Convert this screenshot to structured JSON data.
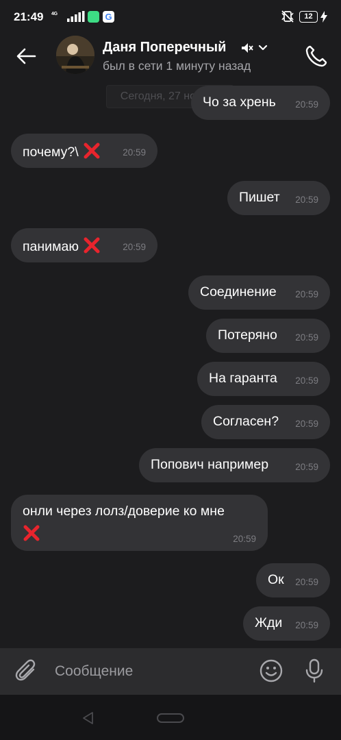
{
  "status_bar": {
    "time": "21:49",
    "network": "4G",
    "battery": "12"
  },
  "header": {
    "contact_name": "Даня Поперечный",
    "contact_status": "был в сети 1 минуту назад"
  },
  "chat": {
    "date_chip": "Сегодня, 27 ноября",
    "messages": [
      {
        "direction": "out",
        "text": "Чо за хрень",
        "time": "20:59",
        "failed": false
      },
      {
        "direction": "in",
        "text": "почему?\\",
        "time": "20:59",
        "failed": true
      },
      {
        "direction": "out",
        "text": "Пишет",
        "time": "20:59",
        "failed": false
      },
      {
        "direction": "in",
        "text": "панимаю",
        "time": "20:59",
        "failed": true
      },
      {
        "direction": "out",
        "text": "Соединение",
        "time": "20:59",
        "failed": false
      },
      {
        "direction": "out",
        "text": "Потеряно",
        "time": "20:59",
        "failed": false
      },
      {
        "direction": "out",
        "text": "На гаранта",
        "time": "20:59",
        "failed": false
      },
      {
        "direction": "out",
        "text": "Согласен?",
        "time": "20:59",
        "failed": false
      },
      {
        "direction": "out",
        "text": "Попович например",
        "time": "20:59",
        "failed": false
      },
      {
        "direction": "in",
        "text": "онли через лолз/доверие ко мне",
        "time": "20:59",
        "failed": true
      },
      {
        "direction": "out",
        "text": "Ок",
        "time": "20:59",
        "failed": false
      },
      {
        "direction": "out",
        "text": "Жди",
        "time": "20:59",
        "failed": false
      }
    ]
  },
  "composer": {
    "placeholder": "Сообщение"
  },
  "icons": {
    "back": "arrow-left-icon",
    "call": "phone-icon",
    "mute": "bell-off-icon",
    "attach": "paperclip-icon",
    "sticker": "smiley-icon",
    "mic": "microphone-icon",
    "failed": "red-cross-icon"
  },
  "colors": {
    "background": "#1c1c1e",
    "bubble": "#333336",
    "composer": "#2c2c2e",
    "failed_mark": "#e8242d"
  }
}
